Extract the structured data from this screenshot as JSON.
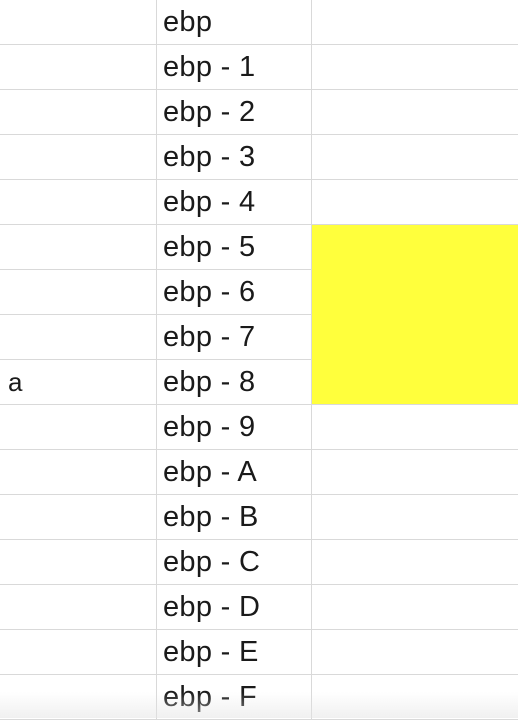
{
  "sheet": {
    "rows": [
      {
        "a": "",
        "b": "ebp",
        "highlight": false
      },
      {
        "a": "",
        "b": "ebp - 1",
        "highlight": false
      },
      {
        "a": "",
        "b": "ebp - 2",
        "highlight": false
      },
      {
        "a": "",
        "b": "ebp - 3",
        "highlight": false
      },
      {
        "a": "",
        "b": "ebp - 4",
        "highlight": false
      },
      {
        "a": "",
        "b": "ebp - 5",
        "highlight": true
      },
      {
        "a": "",
        "b": "ebp - 6",
        "highlight": true
      },
      {
        "a": "",
        "b": "ebp - 7",
        "highlight": true
      },
      {
        "a": "a",
        "b": "ebp - 8",
        "highlight": true
      },
      {
        "a": "",
        "b": "ebp - 9",
        "highlight": false
      },
      {
        "a": "",
        "b": "ebp - A",
        "highlight": false
      },
      {
        "a": "",
        "b": "ebp - B",
        "highlight": false
      },
      {
        "a": "",
        "b": "ebp - C",
        "highlight": false
      },
      {
        "a": "",
        "b": "ebp - D",
        "highlight": false
      },
      {
        "a": "",
        "b": "ebp - E",
        "highlight": false
      },
      {
        "a": "",
        "b": "ebp - F",
        "highlight": false
      }
    ],
    "highlight_color": "#ffff3c",
    "gridline_color": "#d9d9d9"
  }
}
